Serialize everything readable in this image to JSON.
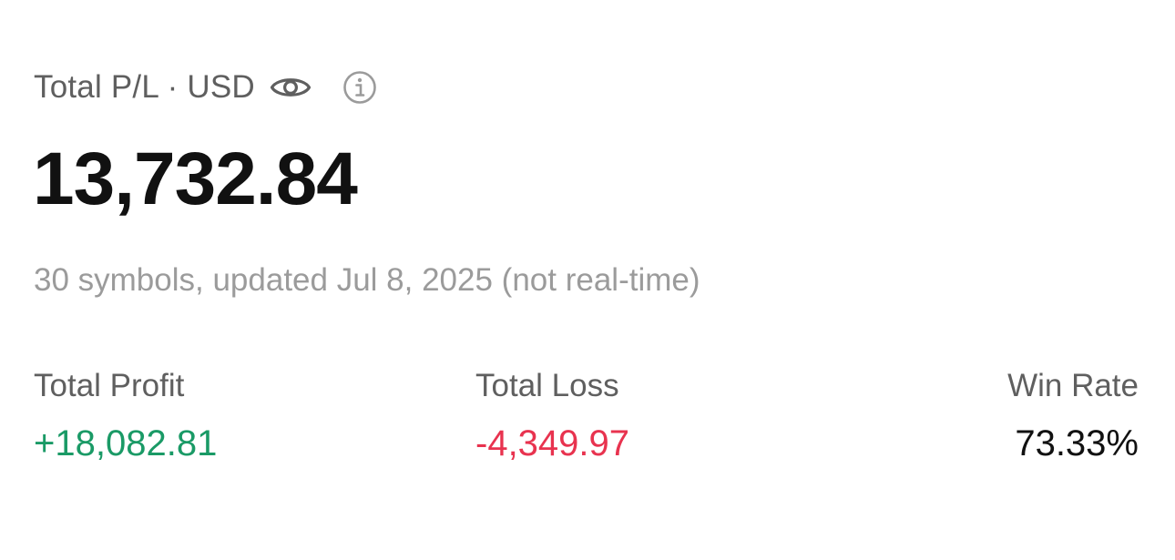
{
  "header": {
    "label": "Total P/L · USD",
    "eye_icon": "eye-icon",
    "info_icon": "info-icon"
  },
  "total_pl": "13,732.84",
  "meta_line": "30 symbols, updated Jul 8, 2025 (not real-time)",
  "stats": {
    "total_profit": {
      "label": "Total Profit",
      "value": "+18,082.81",
      "color": "#1a9a66"
    },
    "total_loss": {
      "label": "Total Loss",
      "value": "-4,349.97",
      "color": "#e8334f"
    },
    "win_rate": {
      "label": "Win Rate",
      "value": "73.33%",
      "color": "#111111"
    }
  },
  "colors": {
    "label_gray": "#5f5f5f",
    "muted_gray": "#9b9b9b",
    "text_dark": "#111111"
  }
}
